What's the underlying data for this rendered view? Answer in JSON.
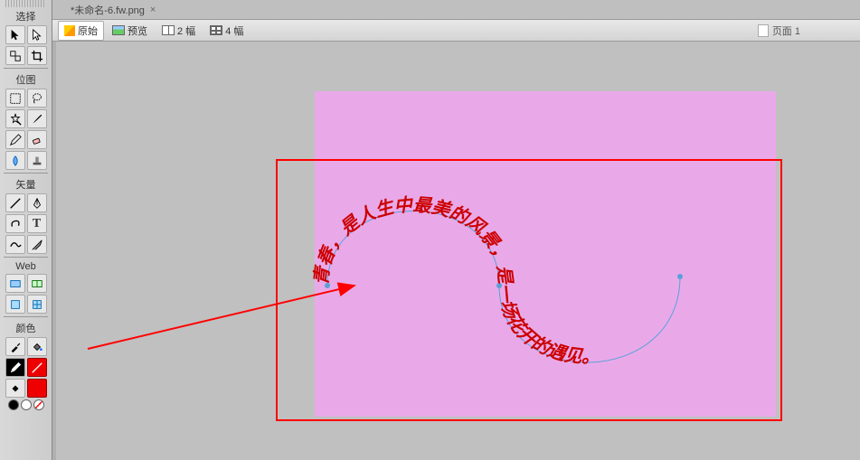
{
  "document": {
    "tab_title": "*未命名-6.fw.png",
    "close_glyph": "×"
  },
  "view_modes": {
    "original": "原始",
    "preview": "预览",
    "split2": "2 幅",
    "split4": "4 幅"
  },
  "page_info": {
    "label": "页面 1"
  },
  "tools": {
    "section_select": "选择",
    "section_bitmap": "位图",
    "section_vector": "矢量",
    "section_web": "Web",
    "section_color": "颜色"
  },
  "canvas_text": {
    "path_text": "青春，是人生中最美的风景，是一场花开的遇见。"
  },
  "colors": {
    "stroke": "#000000",
    "fill": "#ee0000",
    "canvas_bg": "#e9a9e9",
    "highlight_rect": "#ff0000"
  }
}
